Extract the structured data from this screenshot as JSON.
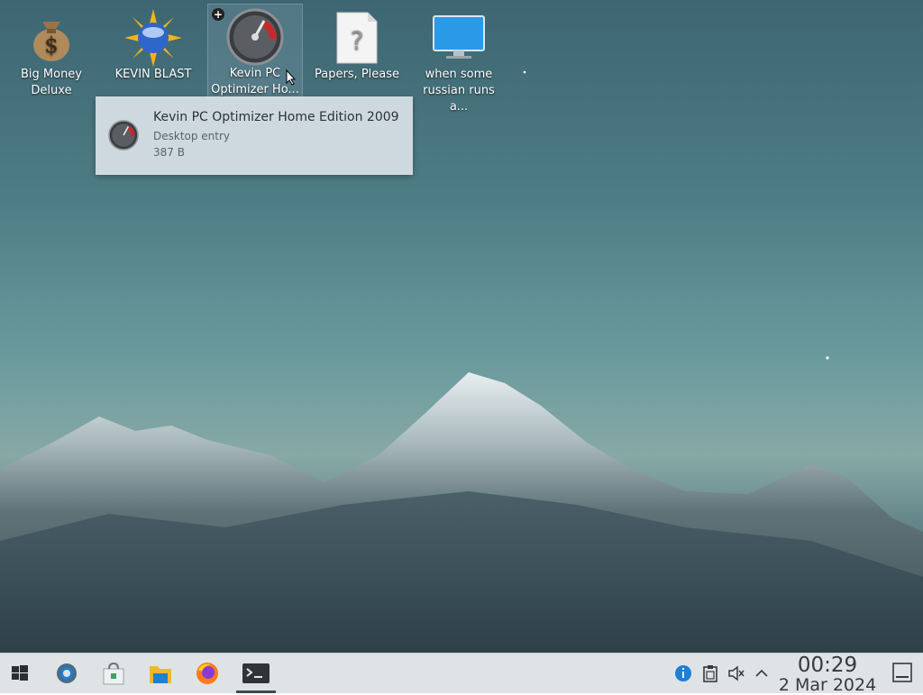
{
  "desktop": {
    "icons": [
      {
        "label": "Big Money Deluxe",
        "icon": "money-bag-icon"
      },
      {
        "label": "KEVIN BLAST",
        "icon": "sun-globe-icon"
      },
      {
        "label": "Kevin PC Optimizer Ho...",
        "icon": "speedometer-icon",
        "selected": true
      },
      {
        "label": "Papers, Please",
        "icon": "unknown-file-icon"
      },
      {
        "label": "when some russian runs a...",
        "icon": "monitor-icon"
      }
    ]
  },
  "tooltip": {
    "title": "Kevin PC Optimizer Home Edition 2009",
    "subtitle": "Desktop entry",
    "size": "387 B"
  },
  "taskbar": {
    "apps": [
      {
        "name": "start-menu",
        "icon": "windows-logo-icon"
      },
      {
        "name": "system-settings",
        "icon": "settings-gear-icon"
      },
      {
        "name": "software-store",
        "icon": "store-bag-icon"
      },
      {
        "name": "file-manager",
        "icon": "folder-icon"
      },
      {
        "name": "firefox",
        "icon": "firefox-icon"
      },
      {
        "name": "terminal",
        "icon": "terminal-icon",
        "active": true
      }
    ],
    "tray": [
      "info-icon",
      "clipboard-icon",
      "volume-muted-icon",
      "chevron-up-icon"
    ],
    "clock": {
      "time": "00:29",
      "date": "2 Mar 2024"
    }
  },
  "colors": {
    "taskbar": "#dfe3e6",
    "accent": "#1d7fd6"
  }
}
